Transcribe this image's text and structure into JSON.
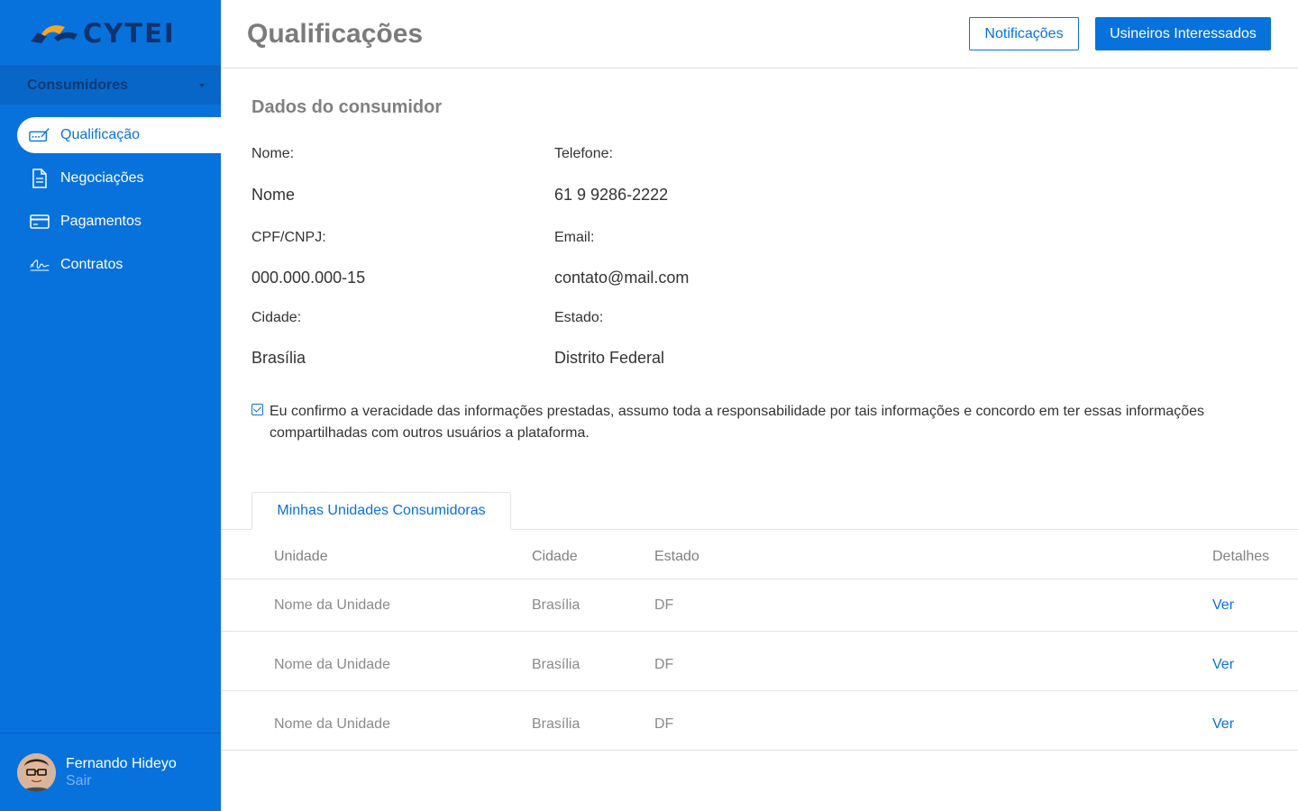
{
  "brand": {
    "name": "CYTEI"
  },
  "sidebar": {
    "section": "Consumidores",
    "items": [
      {
        "label": "Qualificação",
        "icon": "qualification-icon",
        "active": true
      },
      {
        "label": "Negociações",
        "icon": "document-icon",
        "active": false
      },
      {
        "label": "Pagamentos",
        "icon": "credit-card-icon",
        "active": false
      },
      {
        "label": "Contratos",
        "icon": "signature-icon",
        "active": false
      }
    ],
    "user": {
      "name": "Fernando Hideyo",
      "logout": "Sair"
    }
  },
  "header": {
    "title": "Qualificações",
    "notifications_label": "Notificações",
    "interested_label": "Usineiros Interessados"
  },
  "consumer": {
    "title": "Dados do consumidor",
    "fields": {
      "name_label": "Nome:",
      "name_value": "Nome",
      "phone_label": "Telefone:",
      "phone_value": "61 9 9286-2222",
      "doc_label": "CPF/CNPJ:",
      "doc_value": "000.000.000-15",
      "email_label": "Email:",
      "email_value": "contato@mail.com",
      "city_label": "Cidade:",
      "city_value": "Brasília",
      "state_label": "Estado:",
      "state_value": "Distrito Federal"
    },
    "confirm_text": "Eu confirmo a veracidade das informações prestadas, assumo toda a responsabilidade por tais informações e concordo em ter essas informações compartilhadas com outros usuários a plataforma.",
    "confirm_checked": true
  },
  "units": {
    "tab_label": "Minhas Unidades Consumidoras",
    "columns": [
      "Unidade",
      "Cidade",
      "Estado",
      "Detalhes"
    ],
    "rows": [
      {
        "unit": "Nome da Unidade",
        "city": "Brasília",
        "state": "DF",
        "details": "Ver"
      },
      {
        "unit": "Nome da Unidade",
        "city": "Brasília",
        "state": "DF",
        "details": "Ver"
      },
      {
        "unit": "Nome da Unidade",
        "city": "Brasília",
        "state": "DF",
        "details": "Ver"
      }
    ]
  },
  "colors": {
    "primary": "#0772dc",
    "sidebar_dark": "#0866c8",
    "logo_navy": "#10336e",
    "logo_orange": "#f5a623",
    "muted_text": "#808080"
  }
}
